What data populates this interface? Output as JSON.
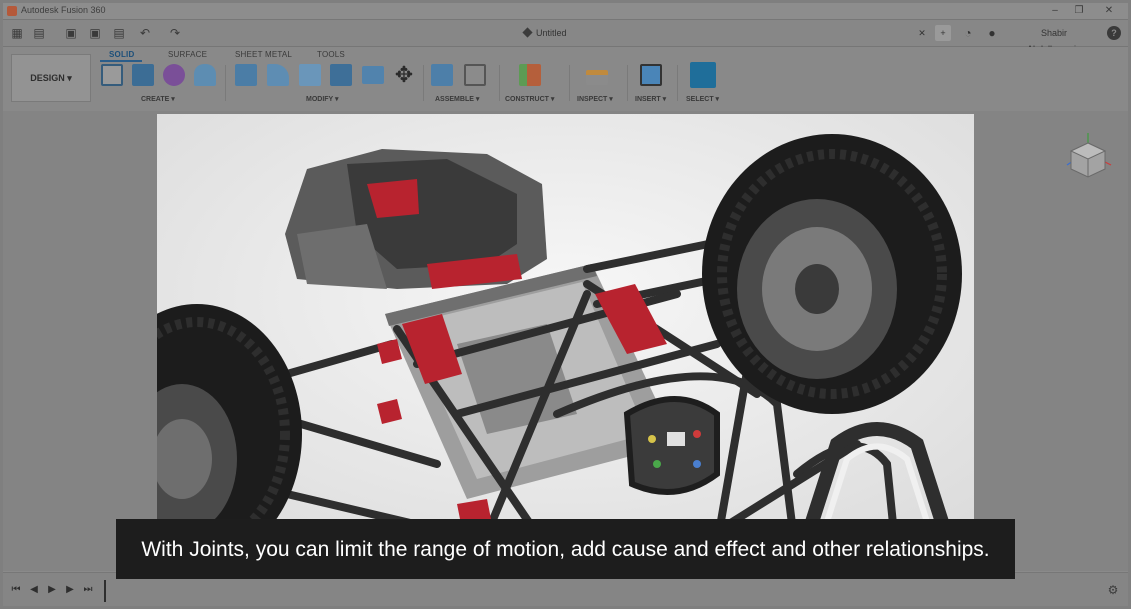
{
  "window": {
    "title": "Autodesk Fusion 360",
    "minimize_glyph": "–",
    "maximize_glyph": "❐",
    "close_glyph": "✕"
  },
  "quick_access": {
    "grid_glyph": "▦",
    "file_glyph": "▤",
    "save_glyph": "▣",
    "undo_glyph": "↶",
    "redo_glyph": "↷",
    "document_name": "Untitled",
    "close_tab_glyph": "✕",
    "user_name": "Shabir Abdulhussein",
    "help_glyph": "?"
  },
  "ribbon": {
    "workspace": "DESIGN ▾",
    "tabs": [
      "SOLID",
      "SURFACE",
      "SHEET METAL",
      "TOOLS"
    ],
    "active_tab": "SOLID",
    "groups": [
      "CREATE ▾",
      "MODIFY ▾",
      "ASSEMBLE ▾",
      "CONSTRUCT ▾",
      "INSPECT ▾",
      "INSERT ▾",
      "SELECT ▾"
    ]
  },
  "caption": {
    "text": "With Joints, you can limit the range of motion, add cause and effect and other relationships."
  },
  "timeline": {
    "first_glyph": "⏮",
    "prev_glyph": "◀",
    "play_glyph": "▶",
    "next_glyph": "▶",
    "last_glyph": "⏭",
    "settings_glyph": "⚙"
  },
  "colors": {
    "accent_red": "#b8232f",
    "frame_dark": "#2e2e2e",
    "tire": "#1c1c1c",
    "brand_blue": "#1c4f7a"
  }
}
